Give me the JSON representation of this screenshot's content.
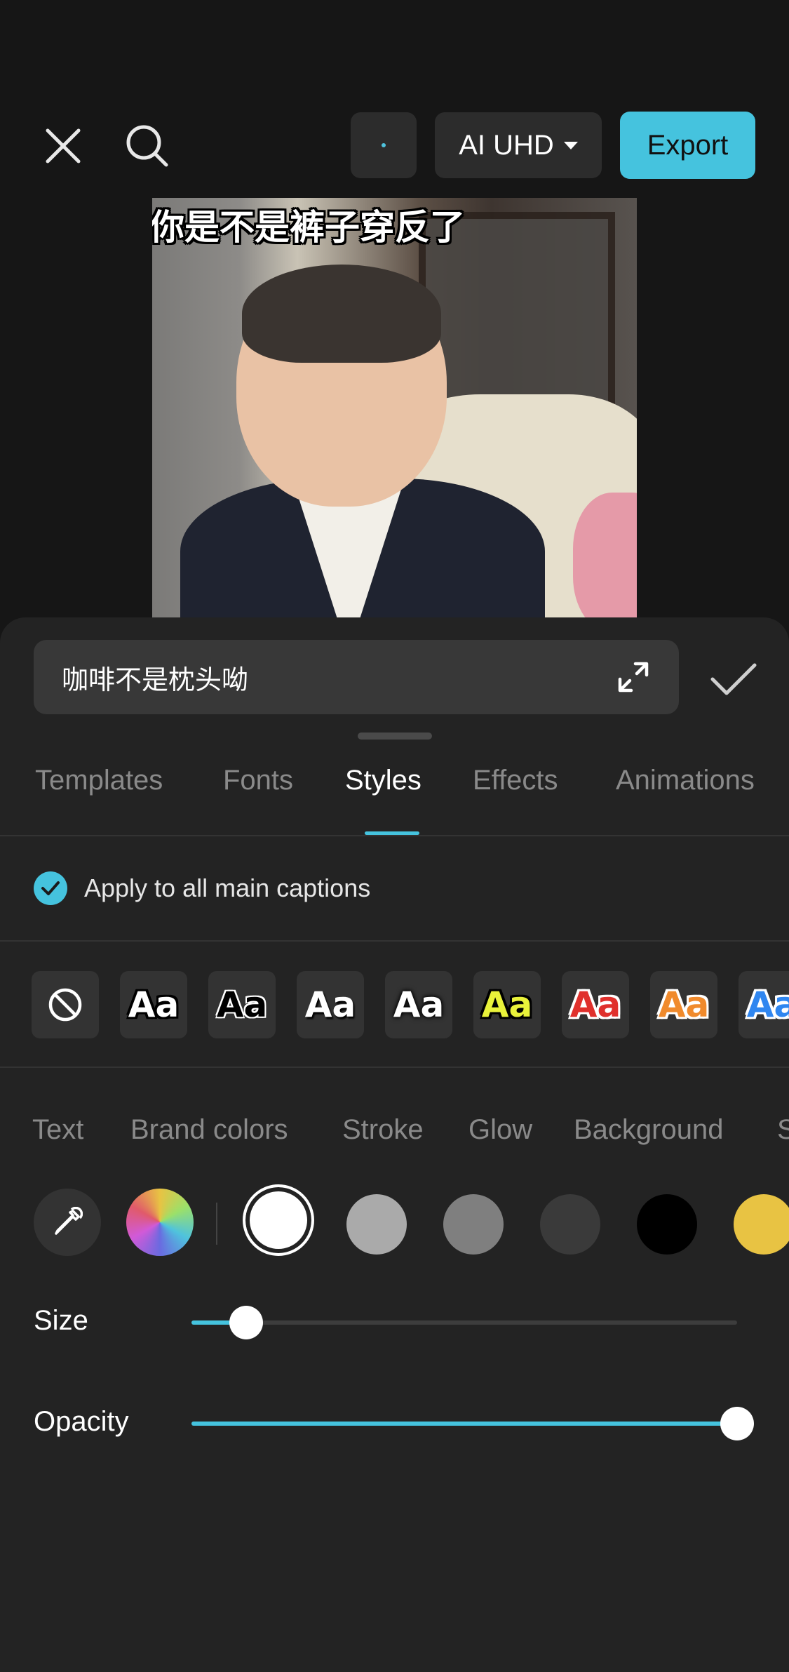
{
  "topbar": {
    "close_icon": "close-icon",
    "search_icon": "search-icon",
    "quality_label": "AI UHD",
    "export_label": "Export"
  },
  "preview": {
    "subtitle": "你是不是裤子穿反了"
  },
  "caption_editor": {
    "text_value": "咖啡不是枕头呦"
  },
  "tabs": [
    {
      "label": "Templates"
    },
    {
      "label": "Fonts"
    },
    {
      "label": "Styles"
    },
    {
      "label": "Effects"
    },
    {
      "label": "Animations"
    }
  ],
  "active_tab": "Styles",
  "apply_all": {
    "label": "Apply to all main captions",
    "checked": true
  },
  "style_presets": {
    "sample_text": "Aa",
    "items": [
      {
        "name": "none",
        "fill": "",
        "stroke": ""
      },
      {
        "name": "white-black-stroke",
        "fill": "#ffffff",
        "stroke": "#000000"
      },
      {
        "name": "black-white-stroke",
        "fill": "#000000",
        "stroke": "#ffffff"
      },
      {
        "name": "white-shadow",
        "fill": "#ffffff",
        "stroke": "#222222"
      },
      {
        "name": "white-glow",
        "fill": "#ffffff",
        "stroke": "#000000"
      },
      {
        "name": "yellow-black-stroke",
        "fill": "#e9f23a",
        "stroke": "#000000"
      },
      {
        "name": "red-white-stroke",
        "fill": "#e0302c",
        "stroke": "#ffffff"
      },
      {
        "name": "orange-white-stroke",
        "fill": "#f08a2c",
        "stroke": "#ffffff"
      },
      {
        "name": "blue-white-stroke",
        "fill": "#2f86f0",
        "stroke": "#ffffff"
      }
    ]
  },
  "style_subtabs": [
    {
      "label": "Text"
    },
    {
      "label": "Brand colors"
    },
    {
      "label": "Stroke"
    },
    {
      "label": "Glow"
    },
    {
      "label": "Background"
    },
    {
      "label": "S"
    }
  ],
  "colors": {
    "eyedropper_icon": "eyedropper-icon",
    "picker_icon": "color-wheel-icon",
    "swatches": [
      "#ffffff",
      "#aaaaaa",
      "#7f7f7f",
      "#3a3a3a",
      "#000000",
      "#e8c343"
    ],
    "selected": "#ffffff"
  },
  "sliders": {
    "size": {
      "label": "Size",
      "value": 0.1
    },
    "opacity": {
      "label": "Opacity",
      "value": 1.0
    }
  },
  "accent_color": "#45c3de"
}
